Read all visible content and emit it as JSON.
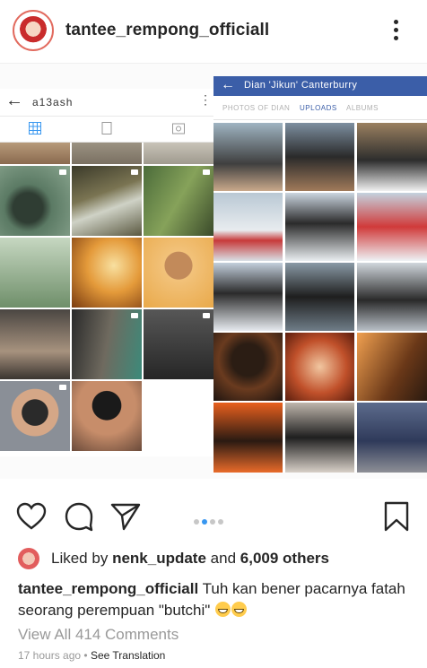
{
  "header": {
    "username": "tantee_rempong_officiall"
  },
  "left_screenshot": {
    "title": "a13ash"
  },
  "right_screenshot": {
    "title": "Dian 'Jikun' Canterburry",
    "tabs": [
      "PHOTOS OF DIAN",
      "UPLOADS",
      "ALBUMS"
    ],
    "active_tab": "UPLOADS"
  },
  "actions": {
    "icons": [
      "heart-icon",
      "comment-icon",
      "share-icon",
      "bookmark-icon"
    ],
    "carousel_count": 4,
    "carousel_active": 2
  },
  "likes": {
    "prefix": "Liked by",
    "user": "nenk_update",
    "and": "and",
    "others": "6,009 others"
  },
  "caption": {
    "user": "tantee_rempong_officiall",
    "text": "Tuh kan bener pacarnya fatah seorang perempuan \"butchi\""
  },
  "comments": {
    "view_all": "View All 414 Comments"
  },
  "time": {
    "ago": "17 hours ago",
    "separator": "•",
    "see_translation": "See Translation"
  },
  "colors": {
    "accent_blue": "#3897f0",
    "facebook_blue": "#3b5ea8"
  }
}
